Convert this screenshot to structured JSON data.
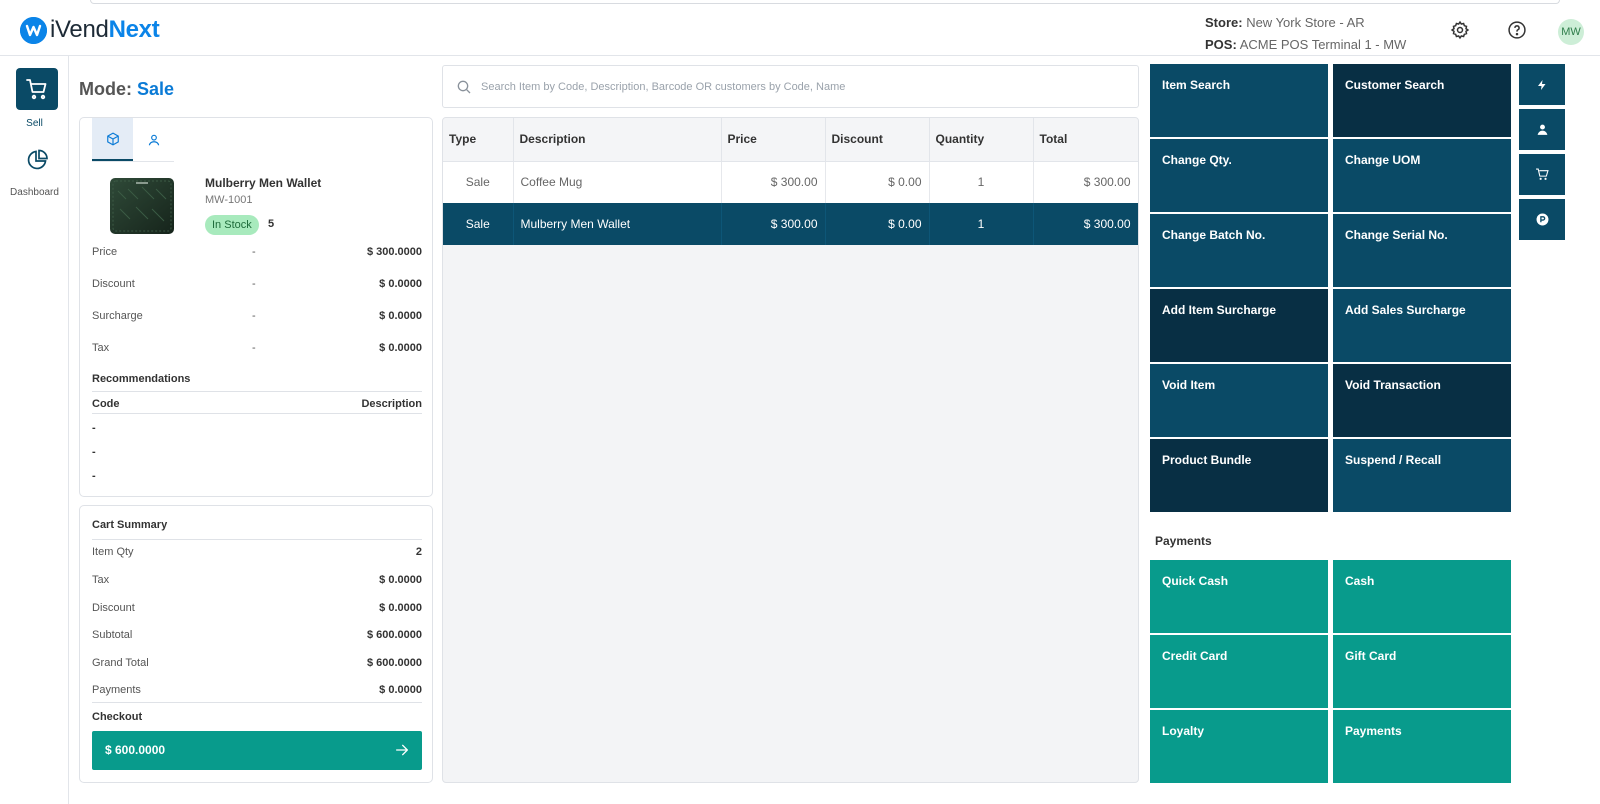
{
  "app": {
    "logo_text_1": "iVend",
    "logo_text_2": "Next",
    "store_label": "Store:",
    "store_value": "New York Store - AR",
    "pos_label": "POS:",
    "pos_value": "ACME POS Terminal 1 - MW",
    "avatar_initials": "MW"
  },
  "nav": {
    "sell_label": "Sell",
    "dashboard_label": "Dashboard"
  },
  "mode": {
    "label": "Mode:",
    "value": "Sale"
  },
  "item": {
    "name": "Mulberry Men Wallet",
    "code": "MW-1001",
    "stock_status": "In Stock",
    "stock_qty": "5",
    "pricing": [
      {
        "label": "Price",
        "mid": "-",
        "value": "$ 300.0000"
      },
      {
        "label": "Discount",
        "mid": "-",
        "value": "$ 0.0000"
      },
      {
        "label": "Surcharge",
        "mid": "-",
        "value": "$ 0.0000"
      },
      {
        "label": "Tax",
        "mid": "-",
        "value": "$ 0.0000"
      }
    ],
    "recommendations_title": "Recommendations",
    "rec_code_header": "Code",
    "rec_desc_header": "Description",
    "rec_rows": [
      "-",
      "-",
      "-"
    ]
  },
  "cart_summary": {
    "title": "Cart Summary",
    "rows": [
      {
        "label": "Item Qty",
        "value": "2"
      },
      {
        "label": "Tax",
        "value": "$ 0.0000"
      },
      {
        "label": "Discount",
        "value": "$ 0.0000"
      },
      {
        "label": "Subtotal",
        "value": "$ 600.0000"
      },
      {
        "label": "Grand Total",
        "value": "$ 600.0000"
      },
      {
        "label": "Payments",
        "value": "$ 0.0000"
      }
    ],
    "checkout_label": "Checkout",
    "checkout_amount": "$ 600.0000"
  },
  "search": {
    "placeholder": "Search Item by Code, Description, Barcode OR customers by Code, Name"
  },
  "cart_table": {
    "headers": [
      "Type",
      "Description",
      "Price",
      "Discount",
      "Quantity",
      "Total"
    ],
    "rows": [
      {
        "type": "Sale",
        "description": "Coffee Mug",
        "price": "$ 300.00",
        "discount": "$ 0.00",
        "quantity": "1",
        "total": "$ 300.00"
      },
      {
        "type": "Sale",
        "description": "Mulberry Men Wallet",
        "price": "$ 300.00",
        "discount": "$ 0.00",
        "quantity": "1",
        "total": "$ 300.00"
      }
    ]
  },
  "actions": [
    "Item Search",
    "Customer Search",
    "Change Qty.",
    "Change UOM",
    "Change Batch No.",
    "Change Serial No.",
    "Add Item Surcharge",
    "Add Sales Surcharge",
    "Void Item",
    "Void Transaction",
    "Product Bundle",
    "Suspend / Recall"
  ],
  "payments": {
    "title": "Payments",
    "buttons": [
      "Quick Cash",
      "Cash",
      "Credit Card",
      "Gift Card",
      "Loyalty",
      "Payments"
    ]
  },
  "colors": {
    "primary": "#0a4a66",
    "primary_dark": "#082f44",
    "teal": "#089b8c",
    "brand_blue": "#0b84e8"
  },
  "icons": {
    "side_buttons": [
      "flash-icon",
      "user-icon",
      "cart-icon",
      "parking-icon"
    ]
  }
}
